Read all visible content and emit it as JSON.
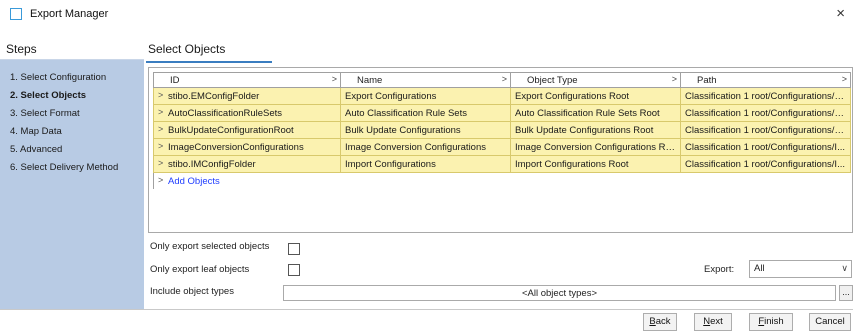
{
  "window": {
    "title": "Export Manager",
    "close_glyph": "×"
  },
  "steps": {
    "header": "Steps",
    "items": [
      {
        "label": "1. Select Configuration",
        "active": false
      },
      {
        "label": "2. Select Objects",
        "active": true
      },
      {
        "label": "3. Select Format",
        "active": false
      },
      {
        "label": "4. Map Data",
        "active": false
      },
      {
        "label": "5. Advanced",
        "active": false
      },
      {
        "label": "6. Select Delivery Method",
        "active": false
      }
    ]
  },
  "main": {
    "title": "Select Objects"
  },
  "table": {
    "columns": [
      "ID",
      "Name",
      "Object Type",
      "Path"
    ],
    "rows": [
      {
        "id": "stibo.EMConfigFolder",
        "name": "Export Configurations",
        "type": "Export Configurations Root",
        "path": "Classification 1 root/Configurations/E..."
      },
      {
        "id": "AutoClassificationRuleSets",
        "name": "Auto Classification Rule Sets",
        "type": "Auto Classification Rule Sets Root",
        "path": "Classification 1 root/Configurations/A..."
      },
      {
        "id": "BulkUpdateConfigurationRoot",
        "name": "Bulk Update Configurations",
        "type": "Bulk Update Configurations Root",
        "path": "Classification 1 root/Configurations/B..."
      },
      {
        "id": "ImageConversionConfigurations",
        "name": "Image Conversion Configurations",
        "type": "Image Conversion Configurations Root",
        "path": "Classification 1 root/Configurations/I..."
      },
      {
        "id": "stibo.IMConfigFolder",
        "name": "Import Configurations",
        "type": "Import Configurations Root",
        "path": "Classification 1 root/Configurations/I..."
      }
    ],
    "add_objects": "Add Objects"
  },
  "options": {
    "only_selected": "Only export selected objects",
    "only_leaf": "Only export leaf objects",
    "include_types": "Include object types",
    "include_types_value": "<All object types>",
    "browse": "...",
    "export_label": "Export:",
    "export_value": "All"
  },
  "buttons": {
    "back": {
      "mn": "B",
      "rest": "ack"
    },
    "next": {
      "mn": "N",
      "rest": "ext"
    },
    "finish": {
      "mn": "F",
      "rest": "inish"
    },
    "cancel": "Cancel"
  },
  "colors": {
    "accent": "#3a7dc0",
    "steps_bg": "#b8cbe4",
    "row_bg": "#fbf2b0",
    "link": "#1f3dff"
  }
}
